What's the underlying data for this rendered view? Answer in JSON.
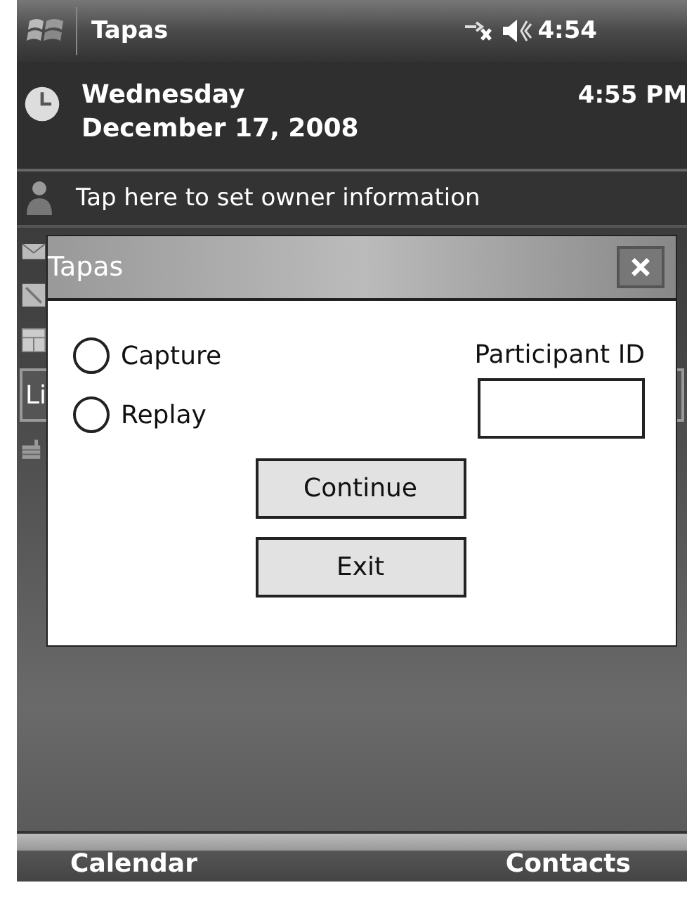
{
  "status_bar": {
    "title": "Tapas",
    "time": "4:54"
  },
  "today": {
    "day": "Wednesday",
    "date": "December 17, 2008",
    "time": "4:55 PM",
    "owner": "Tap here to set owner information"
  },
  "background_field": {
    "value": "Li"
  },
  "dialog": {
    "title": "Tapas",
    "options": [
      {
        "label": "Capture",
        "selected": false
      },
      {
        "label": "Replay",
        "selected": false
      }
    ],
    "participant_label": "Participant ID",
    "buttons": [
      "Continue",
      "Exit"
    ]
  },
  "softkeys": [
    "Calendar",
    "Contacts"
  ]
}
